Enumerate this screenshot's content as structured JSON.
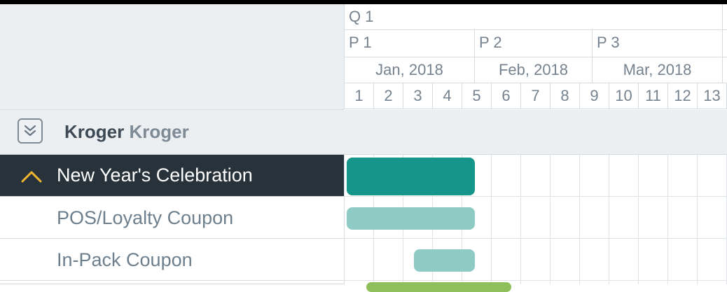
{
  "timeline": {
    "quarters": [
      "Q 1"
    ],
    "periods": [
      "P 1",
      "P 2",
      "P 3"
    ],
    "months": [
      "Jan, 2018",
      "Feb, 2018",
      "Mar, 2018"
    ],
    "weeks": [
      "1",
      "2",
      "3",
      "4",
      "5",
      "6",
      "7",
      "8",
      "9",
      "10",
      "11",
      "12",
      "13"
    ]
  },
  "group": {
    "name": "Kroger",
    "subname": "Kroger"
  },
  "rows": [
    {
      "label": "New Year's Celebration",
      "active": true
    },
    {
      "label": "POS/Loyalty Coupon",
      "active": false
    },
    {
      "label": "In-Pack Coupon",
      "active": false
    }
  ],
  "colors": {
    "event_bar": "#14968a",
    "tactic_bar": "#8ecbc5",
    "partial_bar": "#8fbf5a",
    "active_chevron": "#f2b52e"
  },
  "icons": {
    "collapse": "double-chevron-down-icon",
    "expand_row": "chevron-up-icon"
  }
}
